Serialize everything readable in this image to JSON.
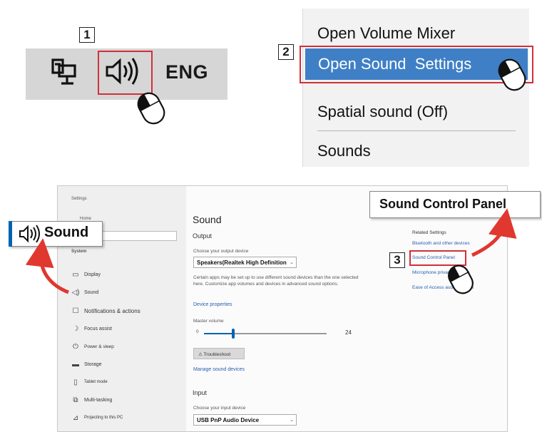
{
  "panel1": {
    "step": "1",
    "network_icon": "network-monitor-icon",
    "speaker_icon": "speaker-icon",
    "language": "ENG"
  },
  "panel2": {
    "step": "2",
    "menu": [
      "Open Volume Mixer",
      "Open Sound  Settings",
      "Spatial sound (Off)",
      "Sounds"
    ],
    "highlight_color": "#3f7fc6"
  },
  "panel3": {
    "step": "3",
    "callout_sound": "Sound",
    "callout_control_panel": "Sound Control Panel",
    "sidebar": {
      "top_label": "Settings",
      "home": "Home",
      "section": "System",
      "items": [
        {
          "icon": "display-icon",
          "label": "Display"
        },
        {
          "icon": "sound-icon",
          "label": "Sound"
        },
        {
          "icon": "notifications-icon",
          "label": "Notifications & actions"
        },
        {
          "icon": "focus-assist-icon",
          "label": "Focus assist"
        },
        {
          "icon": "power-icon",
          "label": "Power & sleep"
        },
        {
          "icon": "storage-icon",
          "label": "Storage"
        },
        {
          "icon": "tablet-icon",
          "label": "Tablet mode"
        },
        {
          "icon": "multitasking-icon",
          "label": "Multi-tasking"
        },
        {
          "icon": "projecting-icon",
          "label": "Projecting to this PC"
        }
      ]
    },
    "main": {
      "title": "Sound",
      "output_heading": "Output",
      "choose_output": "Choose your output device",
      "output_device": "Speakers(Realtek High Definition",
      "info_text": "Certain apps may be set up to use different sound devices than the one selected here. Customize app volumes and devices in advanced sound options.",
      "device_properties": "Device properties",
      "master_volume": "Master volume",
      "volume_min": "0",
      "volume_value": "24",
      "volume_level": 24,
      "troubleshoot": "Troubleshoot",
      "manage_devices": "Manage sound devices",
      "input_heading": "Input",
      "choose_input": "Choose your input device",
      "input_device": "USB PnP Audio Device"
    },
    "related": {
      "heading": "Related Settings",
      "links": [
        "Bluetooth and other devices",
        "Sound Control Panel",
        "Microphone privacy settings",
        "Ease of Access audio settings"
      ]
    },
    "accent_color": "#0063b1",
    "highlight_border_color": "#d0303a",
    "arrow_color": "#e0372e"
  }
}
